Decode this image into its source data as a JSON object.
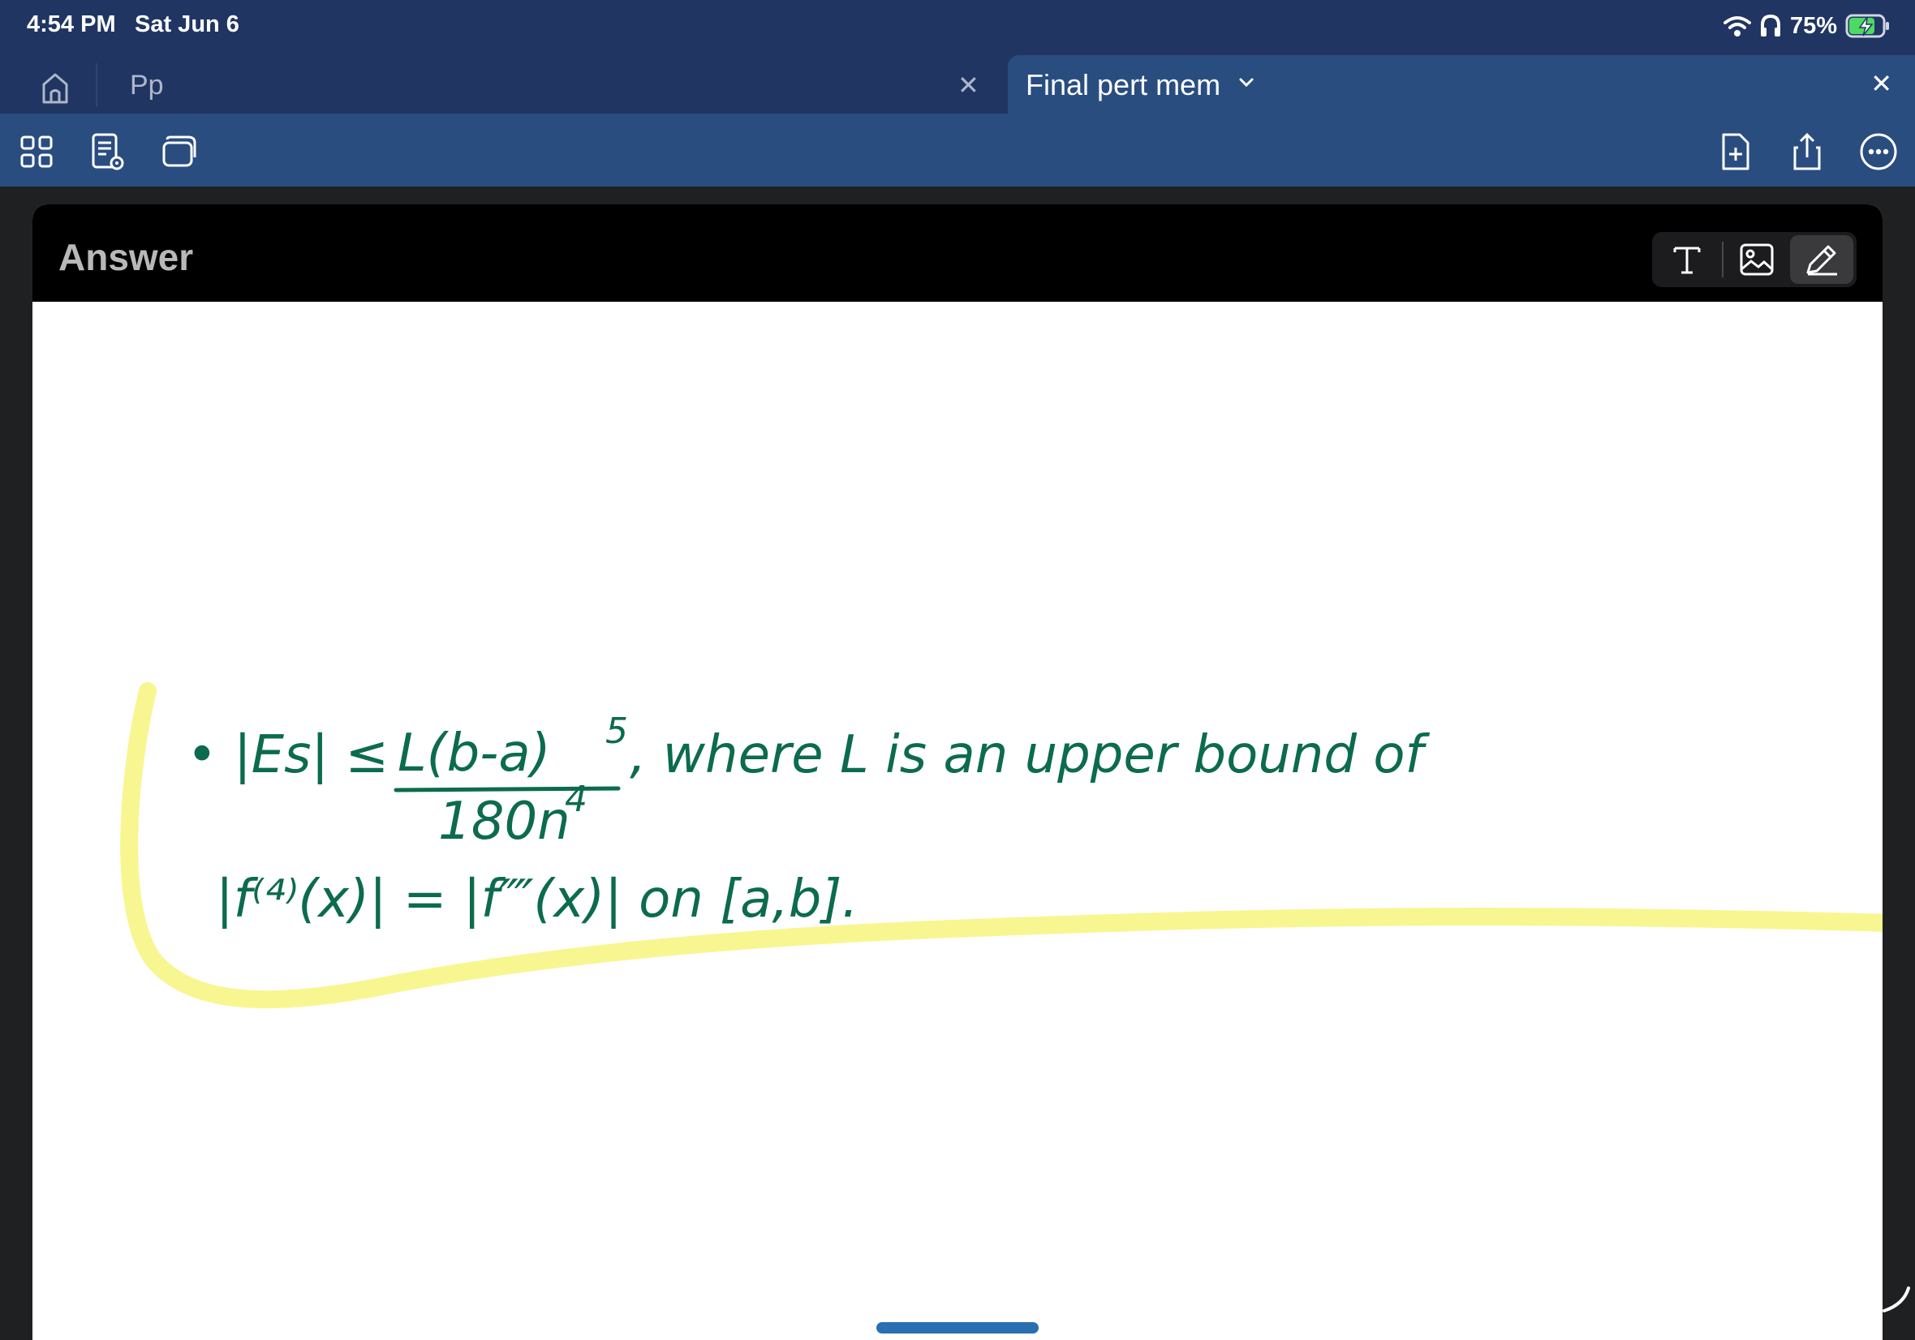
{
  "status_bar": {
    "time": "4:54 PM",
    "date": "Sat Jun 6",
    "battery": "75%",
    "icons": [
      "wifi-icon",
      "headphones-icon",
      "battery-charging-icon"
    ]
  },
  "tabs": [
    {
      "label": "Pp",
      "active": false
    },
    {
      "label": "Final pert mem",
      "active": true
    }
  ],
  "toolbar": {
    "left_icons": [
      "grid-view-icon",
      "document-preview-icon",
      "cards-icon"
    ],
    "right_icons": [
      "new-page-icon",
      "share-icon",
      "more-icon"
    ]
  },
  "card": {
    "title": "Answer",
    "mode_buttons": [
      "text-tool-icon",
      "image-tool-icon",
      "pen-tool-icon"
    ],
    "active_mode": "pen"
  },
  "handwriting": {
    "ink_color": "#0c6b4e",
    "highlight_color": "#f8f58a",
    "line1_prefix": "• |Es| ≤",
    "numerator": "L(b-a)",
    "exponent": "5",
    "line1_suffix": ", where L is an upper bound of",
    "denominator": "180n",
    "denominator_exp": "4",
    "line2": "|f⁽⁴⁾(x)| = |f⁗(x)| on [a,b]."
  }
}
